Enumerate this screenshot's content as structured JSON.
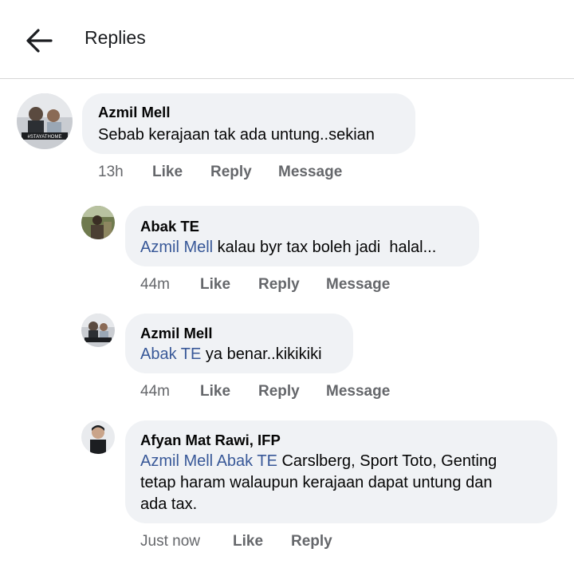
{
  "header": {
    "title": "Replies"
  },
  "comments": [
    {
      "author": "Azmil Mell",
      "text": "Sebab kerajaan tak ada untung..sekian",
      "time": "13h",
      "like": "Like",
      "reply": "Reply",
      "message": "Message",
      "avatar_caption": "#STAYATHOME"
    },
    {
      "author": "Abak TE",
      "mention": "Azmil Mell",
      "text": " kalau byr tax boleh jadi  halal...",
      "time": "44m",
      "like": "Like",
      "reply": "Reply",
      "message": "Message"
    },
    {
      "author": "Azmil Mell",
      "mention": "Abak TE",
      "text": " ya benar..kikikiki",
      "time": "44m",
      "like": "Like",
      "reply": "Reply",
      "message": "Message"
    },
    {
      "author": "Afyan Mat Rawi, IFP",
      "mention": "Azmil Mell Abak TE",
      "text_line1": " Carslberg, Sport Toto, Genting",
      "text_line2": "tetap haram walaupun kerajaan dapat untung dan",
      "text_line3": "ada tax.",
      "time": "Just now",
      "like": "Like",
      "reply": "Reply"
    }
  ],
  "colors": {
    "bubble": "#f0f2f5",
    "mention": "#385898",
    "meta": "#65676b",
    "divider": "#d6d6d6"
  }
}
